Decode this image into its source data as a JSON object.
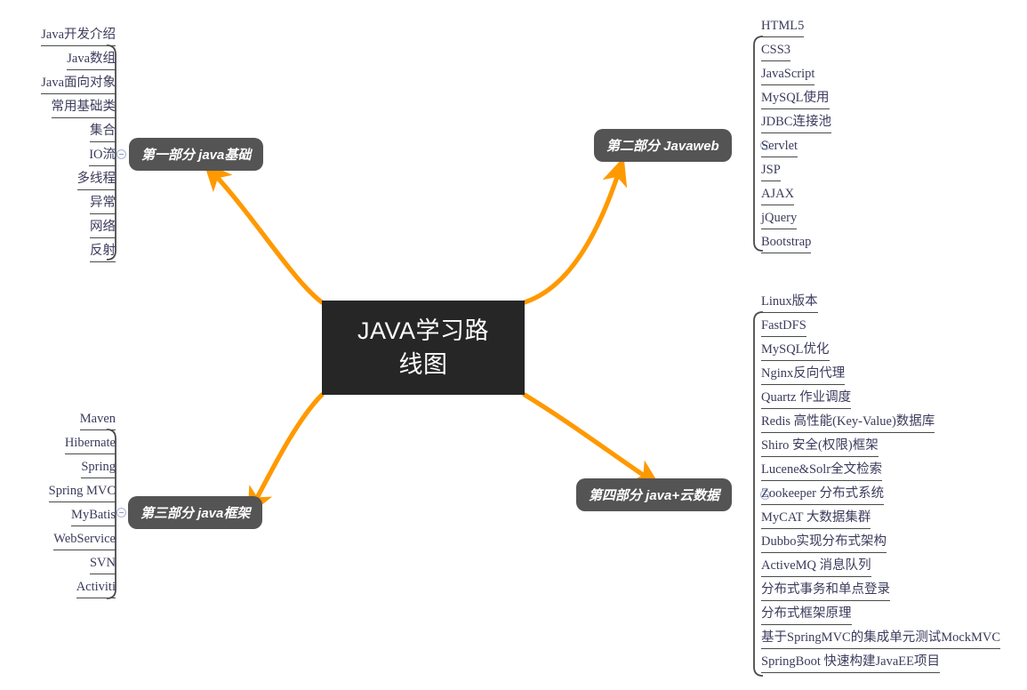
{
  "diagram": {
    "title": "JAVA学习路线图",
    "type": "mindmap",
    "accent_color": "#FF9900",
    "central_bg": "#262626",
    "central_text_color": "#FFFFFF",
    "branch_bg": "#545454",
    "branch_text_color": "#FFFFFF",
    "leaf_text_color": "#3B3B5C",
    "leaf_rule_color": "#4A4A4A",
    "background": "#FFFFFF"
  },
  "central": {
    "line1": "JAVA学习路",
    "line2": "线图"
  },
  "branches": [
    {
      "id": "part1",
      "label": "第一部分 java基础",
      "side": "left",
      "items": [
        "Java开发介绍",
        "Java数组",
        "Java面向对象",
        "常用基础类",
        "集合",
        "IO流",
        "多线程",
        "异常",
        "网络",
        "反射"
      ]
    },
    {
      "id": "part2",
      "label": "第二部分 Javaweb",
      "side": "right",
      "items": [
        "HTML5",
        "CSS3",
        "JavaScript",
        "MySQL使用",
        "JDBC连接池",
        "Servlet",
        "JSP",
        "AJAX",
        "jQuery",
        "Bootstrap"
      ]
    },
    {
      "id": "part3",
      "label": "第三部分 java框架",
      "side": "left",
      "items": [
        "Maven",
        "Hibernate",
        "Spring",
        "Spring MVC",
        "MyBatis",
        "WebService",
        "SVN",
        "Activiti"
      ]
    },
    {
      "id": "part4",
      "label": "第四部分 java+云数据",
      "side": "right",
      "items": [
        "Linux版本",
        "FastDFS",
        "MySQL优化",
        "Nginx反向代理",
        "Quartz 作业调度",
        "Redis 高性能(Key-Value)数据库",
        "Shiro 安全(权限)框架",
        "Lucene&Solr全文检索",
        "Zookeeper 分布式系统",
        "MyCAT 大数据集群",
        "Dubbo实现分布式架构",
        "ActiveMQ 消息队列",
        "分布式事务和单点登录",
        "分布式框架原理",
        "基于SpringMVC的集成单元测试MockMVC",
        "SpringBoot 快速构建JavaEE项目"
      ]
    }
  ],
  "icons": {
    "collapse": "collapse-toggle-icon"
  }
}
